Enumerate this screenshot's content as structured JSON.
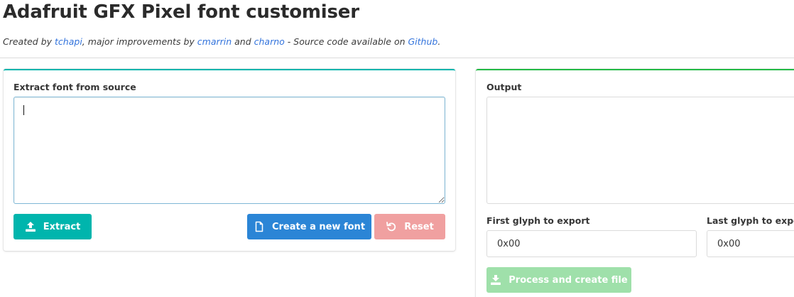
{
  "header": {
    "title": "Adafruit GFX Pixel font customiser",
    "subtitle": {
      "prefix": "Created by ",
      "author1": "tchapi",
      "mid1": ", major improvements by ",
      "author2": "cmarrin",
      "mid2": " and ",
      "author3": "charno",
      "mid3": " - Source code available on ",
      "repo": "Github",
      "suffix": "."
    }
  },
  "source_panel": {
    "label": "Extract font from source",
    "textarea_value": "",
    "buttons": {
      "extract": "Extract",
      "create": "Create a new font",
      "reset": "Reset"
    }
  },
  "output_panel": {
    "label": "Output",
    "textarea_value": "",
    "first_glyph_label": "First glyph to export",
    "first_glyph_value": "0x00",
    "last_glyph_label": "Last glyph to export",
    "last_glyph_value": "0x00",
    "process_button": "Process and create file"
  },
  "colors": {
    "teal": "#00b5ad",
    "blue": "#2b85d6",
    "red_disabled": "#f0a0a0",
    "green_disabled": "#9fe0aa",
    "link": "#3273dc"
  }
}
